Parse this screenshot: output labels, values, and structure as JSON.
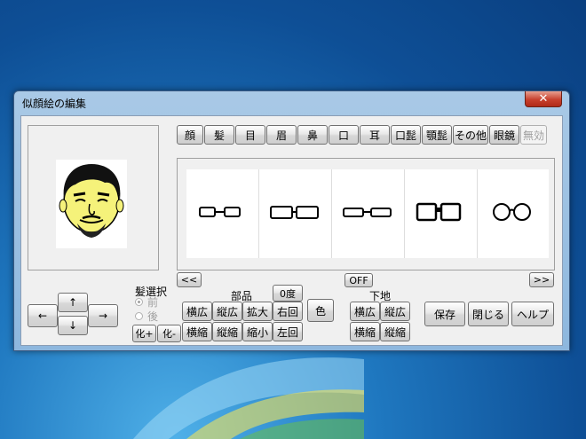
{
  "window": {
    "title": "似顔絵の編集",
    "close_label": "✕"
  },
  "category_tabs": [
    "顔",
    "髪",
    "目",
    "眉",
    "鼻",
    "口",
    "耳",
    "口髭",
    "顎髭",
    "その他",
    "眼鏡",
    "無効"
  ],
  "parts_palette": {
    "items": [
      "glasses-rectangular-small",
      "glasses-rectangular-wide",
      "glasses-thin-wide",
      "glasses-square-bold",
      "glasses-round"
    ],
    "prev_label": "<<",
    "next_label": ">>"
  },
  "move": {
    "up": "↑",
    "down": "↓",
    "left": "←",
    "right": "→"
  },
  "hair_select": {
    "label": "髪選択",
    "options": [
      "前",
      "後"
    ],
    "selected": "前",
    "shrink_up": "化+",
    "shrink_down": "化-"
  },
  "parts": {
    "label": "部品",
    "widen": "横広",
    "v_widen": "縦広",
    "enlarge": "拡大",
    "rotate_right": "右回",
    "narrow": "横縮",
    "v_narrow": "縦縮",
    "shrink": "縮小",
    "rotate_left": "左回",
    "degree": "0度",
    "color": "色"
  },
  "base": {
    "label": "下地",
    "toggle": "OFF",
    "widen": "横広",
    "v_widen": "縦広",
    "narrow": "横縮",
    "v_narrow": "縦縮"
  },
  "actions": {
    "save": "保存",
    "close": "閉じる",
    "help": "ヘルプ"
  }
}
